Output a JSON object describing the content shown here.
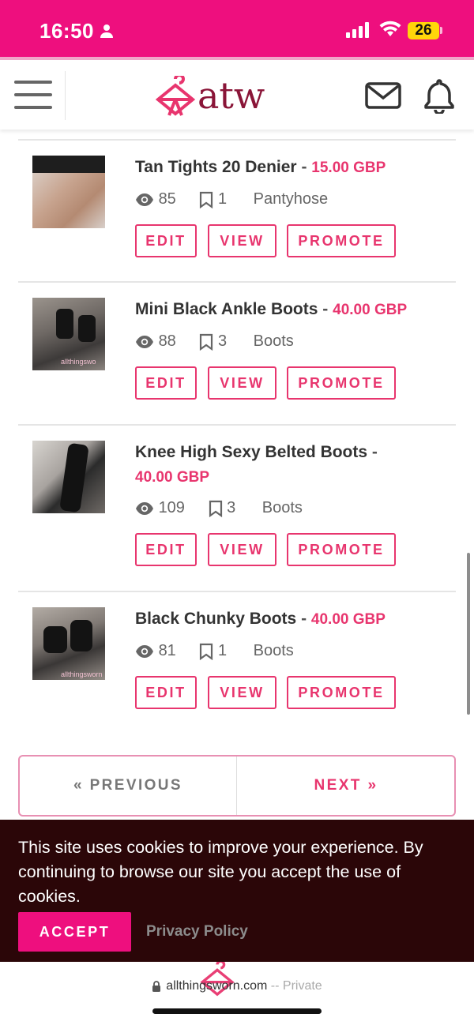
{
  "status_bar": {
    "time": "16:50",
    "battery": "26"
  },
  "header": {
    "logo_text": "atw"
  },
  "listings": [
    {
      "title": "Tan Tights 20 Denier",
      "price": "15.00 GBP",
      "views": "85",
      "saves": "1",
      "category": "Pantyhose"
    },
    {
      "title": "Mini Black Ankle Boots",
      "price": "40.00 GBP",
      "views": "88",
      "saves": "3",
      "category": "Boots",
      "thumb_watermark": "allthingswo"
    },
    {
      "title": "Knee High Sexy Belted Boots",
      "price": "40.00 GBP",
      "views": "109",
      "saves": "3",
      "category": "Boots"
    },
    {
      "title": "Black Chunky Boots",
      "price": "40.00 GBP",
      "views": "81",
      "saves": "1",
      "category": "Boots",
      "thumb_watermark": "allthingsworn"
    }
  ],
  "actions": {
    "edit": "EDIT",
    "view": "VIEW",
    "promote": "PROMOTE",
    "separator": "-"
  },
  "pagination": {
    "previous": "« PREVIOUS",
    "next": "NEXT »"
  },
  "cookie_banner": {
    "message": "This site uses cookies to improve your experience. By continuing to browse our site you accept the use of cookies.",
    "accept": "ACCEPT",
    "privacy": "Privacy Policy"
  },
  "browser": {
    "url": "allthingsworn.com",
    "suffix": " -- Private"
  },
  "colors": {
    "brand_pink": "#ee0f7e",
    "accent": "#e8356e",
    "logo_maroon": "#8a1538",
    "cookie_bg": "#2b0608"
  }
}
